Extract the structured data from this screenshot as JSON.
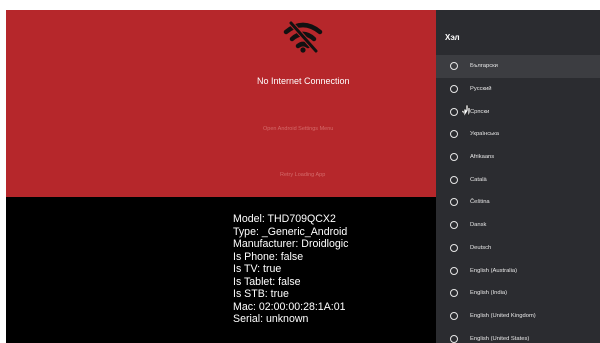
{
  "main": {
    "error_title": "No Internet Connection",
    "open_settings_label": "Open Android Settings Menu",
    "retry_label": "Retry Loading App",
    "icon": "wifi-off-icon"
  },
  "device_info": [
    "Model: THD709QCX2",
    "Type: _Generic_Android",
    "Manufacturer: Droidlogic",
    "Is Phone: false",
    "Is TV: true",
    "Is Tablet: false",
    "Is STB: true",
    "Mac: 02:00:00:28:1A:01",
    "Serial: unknown"
  ],
  "language_panel": {
    "title": "Хэл",
    "items": [
      "Български",
      "Русский",
      "Српски",
      "Українська",
      "Afrikaans",
      "Català",
      "Čeština",
      "Dansk",
      "Deutsch",
      "English (Australia)",
      "English (India)",
      "English (United Kingdom)",
      "English (United States)"
    ],
    "selected_index": 0
  },
  "colors": {
    "error_red": "#b6272b",
    "panel_dark": "#2b2c30",
    "selected_row": "#3c3d41"
  }
}
